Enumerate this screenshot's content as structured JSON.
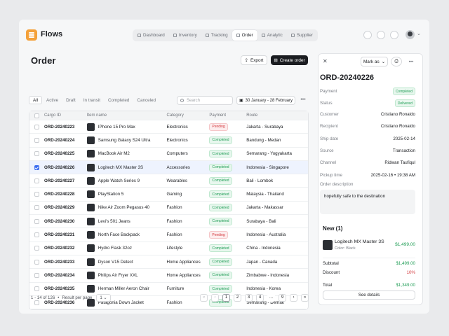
{
  "app": {
    "brand": "Flows"
  },
  "nav": [
    {
      "label": "Dashboard",
      "active": false
    },
    {
      "label": "Inventory",
      "active": false
    },
    {
      "label": "Tracking",
      "active": false
    },
    {
      "label": "Order",
      "active": true
    },
    {
      "label": "Analytic",
      "active": false
    },
    {
      "label": "Supplier",
      "active": false
    }
  ],
  "page": {
    "title": "Order",
    "export_label": "Export",
    "create_label": "Create order"
  },
  "tabs": [
    "All",
    "Active",
    "Draft",
    "In transit",
    "Completed",
    "Canceled"
  ],
  "search": {
    "placeholder": "Search"
  },
  "date_range": "30 January - 28 February",
  "table": {
    "headers": [
      "Cargo ID",
      "Item name",
      "Category",
      "Payment",
      "Route"
    ],
    "rows": [
      {
        "id": "ORD-20240223",
        "item": "IPhone 15 Pro Max",
        "category": "Electronics",
        "payment": "Pending",
        "route": "Jakarta - Surabaya",
        "checked": false
      },
      {
        "id": "ORD-20240224",
        "item": "Samsung Galaxy S24 Ultra",
        "category": "Electronics",
        "payment": "Completed",
        "route": "Bandung - Medan",
        "checked": false
      },
      {
        "id": "ORD-20240225",
        "item": "MacBook Air M2",
        "category": "Computers",
        "payment": "Completed",
        "route": "Semarang - Yogyakarta",
        "checked": false
      },
      {
        "id": "ORD-20240226",
        "item": "Logitech MX Master 3S",
        "category": "Accessories",
        "payment": "Completed",
        "route": "Indonesia - Singapore",
        "checked": true
      },
      {
        "id": "ORD-20240227",
        "item": "Apple Watch Series 9",
        "category": "Wearables",
        "payment": "Completed",
        "route": "Bali - Lombok",
        "checked": false
      },
      {
        "id": "ORD-20240228",
        "item": "PlayStation 5",
        "category": "Gaming",
        "payment": "Completed",
        "route": "Malaysia - Thailand",
        "checked": false
      },
      {
        "id": "ORD-20240229",
        "item": "Nike Air Zoom Pegasus 40",
        "category": "Fashion",
        "payment": "Completed",
        "route": "Jakarta - Makassar",
        "checked": false
      },
      {
        "id": "ORD-20240230",
        "item": "Levi's 501 Jeans",
        "category": "Fashion",
        "payment": "Completed",
        "route": "Surabaya - Bali",
        "checked": false
      },
      {
        "id": "ORD-20240231",
        "item": "North Face Backpack",
        "category": "Fashion",
        "payment": "Pending",
        "route": "Indonesia - Australia",
        "checked": false
      },
      {
        "id": "ORD-20240232",
        "item": "Hydro Flask 32oz",
        "category": "Lifestyle",
        "payment": "Completed",
        "route": "China - Indonesia",
        "checked": false
      },
      {
        "id": "ORD-20240233",
        "item": "Dyson V15 Detect",
        "category": "Home Appliances",
        "payment": "Completed",
        "route": "Japan - Canada",
        "checked": false
      },
      {
        "id": "ORD-20240234",
        "item": "Philips Air Fryer XXL",
        "category": "Home Appliances",
        "payment": "Completed",
        "route": "Zimbabwe - Indonesia",
        "checked": false
      },
      {
        "id": "ORD-20240235",
        "item": "Herman Miller Aeron Chair",
        "category": "Furniture",
        "payment": "Completed",
        "route": "Indonesia - Korea",
        "checked": false
      },
      {
        "id": "ORD-20240236",
        "item": "Patagonia Down Jacket",
        "category": "Fashion",
        "payment": "Completed",
        "route": "Semarang - Demak",
        "checked": false
      }
    ]
  },
  "pager": {
    "summary": "1 - 14 of 126",
    "per_page_label": "Result per page",
    "per_page": "1",
    "pages": [
      "1",
      "2",
      "3",
      "4",
      "...",
      "9"
    ],
    "current": "1"
  },
  "detail": {
    "mark_as": "Mark as",
    "order_id": "ORD-20240226",
    "fields": [
      {
        "k": "Payment",
        "v": "Completed",
        "badge": true
      },
      {
        "k": "Status",
        "v": "Delivered",
        "badge": true
      },
      {
        "k": "Customer",
        "v": "Cristiano Ronaldo",
        "badge": false
      },
      {
        "k": "Recipient",
        "v": "Cristiano Ronaldo",
        "badge": false
      },
      {
        "k": "Ship date",
        "v": "2025-02-14",
        "badge": false
      },
      {
        "k": "Source",
        "v": "Transaction",
        "badge": false
      },
      {
        "k": "Channel",
        "v": "Ridwan Taufiqul",
        "badge": false
      },
      {
        "k": "Pickup time",
        "v": "2025-02-16 • 19:38 AM",
        "badge": false
      }
    ],
    "description_label": "Order description",
    "description": "hopefully safe to the destination",
    "new_title": "New (1)",
    "item_name": "Logitech MX Master 3S",
    "item_color": "Color: Black",
    "item_price": "$1,499.00",
    "subtotal_label": "Subtotal",
    "subtotal": "$1,499.00",
    "discount_label": "Discount",
    "discount": "10%",
    "total_label": "Total",
    "total": "$1,349.00",
    "see_details": "See details"
  },
  "colors": {
    "accent": "#f4a13a",
    "primary_dark": "#1b1d21",
    "success": "#1f9d55",
    "danger": "#d2363a",
    "selected_row": "#eef3fe",
    "checkbox": "#3c6ef0"
  }
}
